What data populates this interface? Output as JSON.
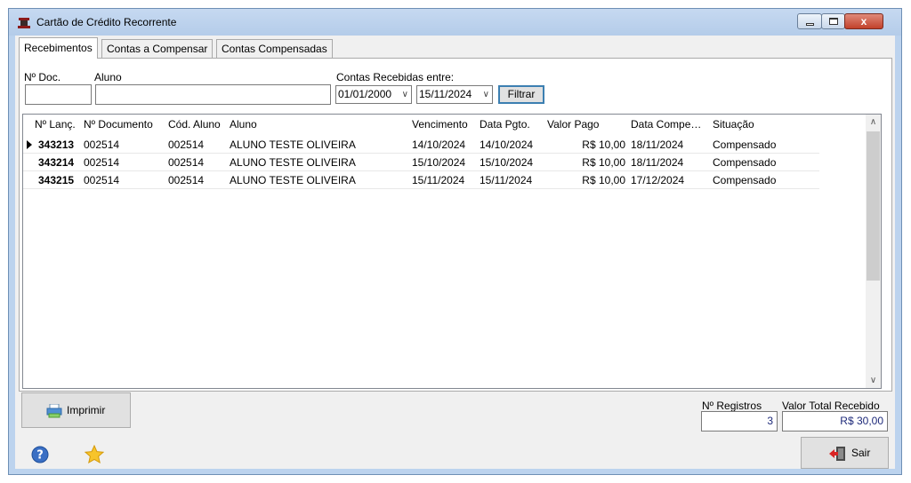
{
  "window": {
    "title": "Cartão de Crédito Recorrente",
    "close_glyph": "x"
  },
  "tabs": [
    {
      "label": "Recebimentos"
    },
    {
      "label": "Contas a Compensar"
    },
    {
      "label": "Contas Compensadas"
    }
  ],
  "filters": {
    "doc_label": "Nº Doc.",
    "doc_value": "",
    "aluno_label": "Aluno",
    "aluno_value": "",
    "range_label": "Contas Recebidas entre:",
    "date_from": "01/01/2000",
    "date_to": "15/11/2024",
    "filter_button": "Filtrar"
  },
  "grid": {
    "columns": [
      "Nº Lanç.",
      "Nº Documento",
      "Cód. Aluno",
      "Aluno",
      "Vencimento",
      "Data Pgto.",
      "Valor Pago",
      "Data Compe…",
      "Situação"
    ],
    "rows": [
      {
        "lanc": "343213",
        "doc": "002514",
        "cod": "002514",
        "aluno": "ALUNO TESTE OLIVEIRA",
        "venc": "14/10/2024",
        "pgto": "14/10/2024",
        "valor": "R$ 10,00",
        "comp": "18/11/2024",
        "sit": "Compensado"
      },
      {
        "lanc": "343214",
        "doc": "002514",
        "cod": "002514",
        "aluno": "ALUNO TESTE OLIVEIRA",
        "venc": "15/10/2024",
        "pgto": "15/10/2024",
        "valor": "R$ 10,00",
        "comp": "18/11/2024",
        "sit": "Compensado"
      },
      {
        "lanc": "343215",
        "doc": "002514",
        "cod": "002514",
        "aluno": "ALUNO TESTE OLIVEIRA",
        "venc": "15/11/2024",
        "pgto": "15/11/2024",
        "valor": "R$ 10,00",
        "comp": "17/12/2024",
        "sit": "Compensado"
      }
    ]
  },
  "footer": {
    "print_button": "Imprimir",
    "records_label": "Nº Registros",
    "records_value": "3",
    "total_label": "Valor Total Recebido",
    "total_value": "R$ 30,00",
    "exit_button": "Sair"
  },
  "icons": {
    "help": "help-icon",
    "favorite": "star-icon",
    "print": "printer-icon",
    "exit": "exit-door-icon"
  }
}
